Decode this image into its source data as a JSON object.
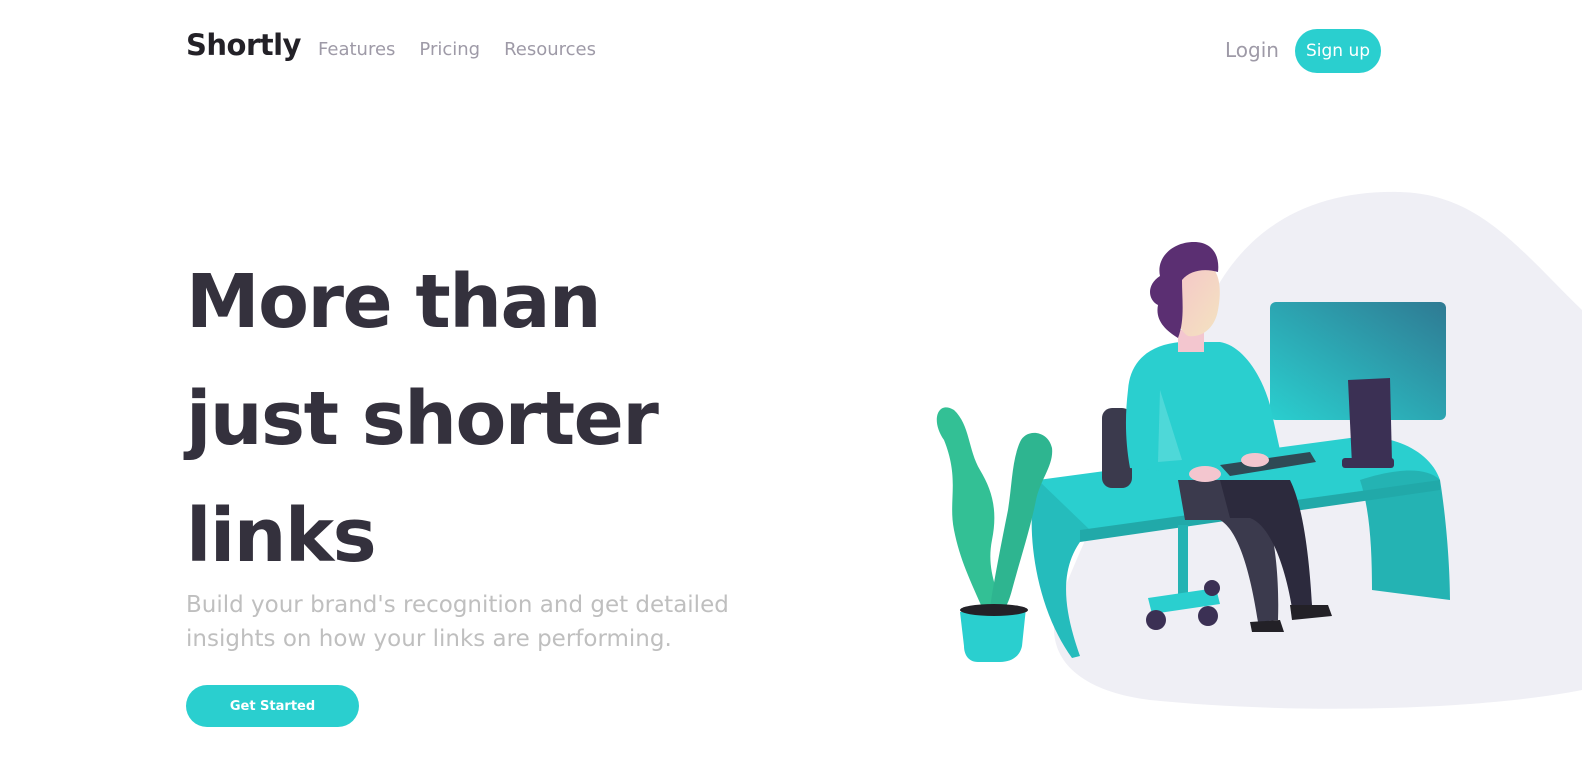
{
  "header": {
    "logo": "Shortly",
    "nav": [
      {
        "label": "Features"
      },
      {
        "label": "Pricing"
      },
      {
        "label": "Resources"
      }
    ],
    "login_label": "Login",
    "signup_label": "Sign up"
  },
  "hero": {
    "title_lines": [
      "More than",
      "just shorter",
      "links"
    ],
    "subtitle": "Build your brand's recognition and get detailed insights on how your links are performing.",
    "cta_label": "Get Started"
  },
  "colors": {
    "brand_cyan": "#2acfcf",
    "dark_violet": "#3b3054",
    "grayish_violet": "#9e9aa7",
    "very_dark_blue": "#34313d"
  },
  "illustration": {
    "icon": "person-working-illustration"
  }
}
